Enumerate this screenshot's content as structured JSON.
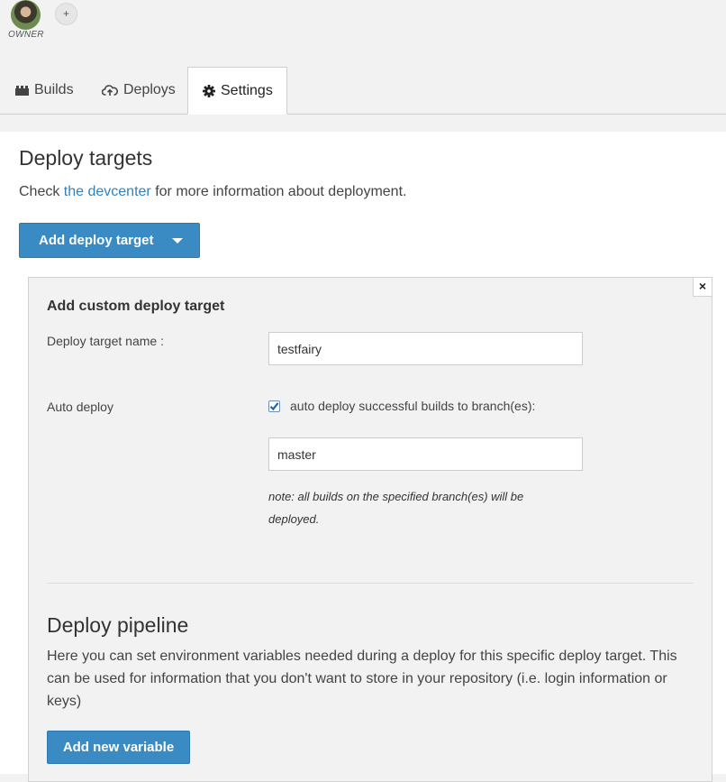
{
  "owner": {
    "role_label": "OWNER",
    "add_label": "+"
  },
  "tabs": [
    {
      "label": "Builds",
      "icon": "builds-icon"
    },
    {
      "label": "Deploys",
      "icon": "cloud-upload-icon"
    },
    {
      "label": "Settings",
      "icon": "gear-icon",
      "active": true
    }
  ],
  "main": {
    "title": "Deploy targets",
    "info_prefix": "Check ",
    "info_link": "the devcenter",
    "info_suffix": " for more information about deployment.",
    "add_target_label": "Add deploy target"
  },
  "panel": {
    "title": "Add custom deploy target",
    "close_label": "×",
    "name_label": "Deploy target name :",
    "name_value": "testfairy",
    "auto_deploy_label": "Auto deploy",
    "auto_deploy_checked": true,
    "auto_deploy_checkbox_label": "auto deploy successful builds to branch(es):",
    "branch_value": "master",
    "note": "note: all builds on the specified branch(es) will be deployed."
  },
  "pipeline": {
    "title": "Deploy pipeline",
    "description": "Here you can set environment variables needed during a deploy for this specific deploy target. This can be used for information that you don't want to store in your repository (i.e. login information or keys)",
    "add_variable_label": "Add new variable"
  },
  "colors": {
    "primary_button": "#3a8ac4",
    "link": "#3580b8",
    "panel_bg": "#f2f2f2"
  }
}
